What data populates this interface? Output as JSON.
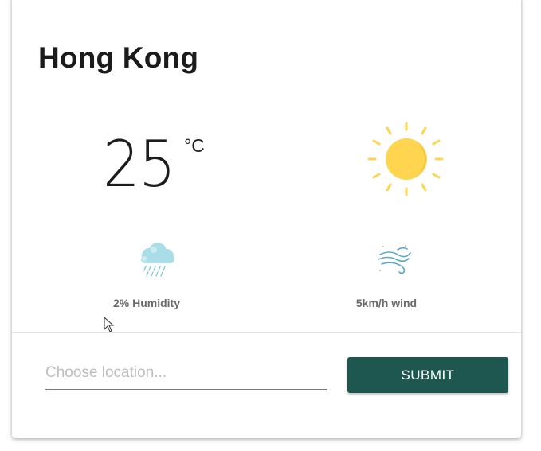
{
  "weather": {
    "city": "Hong Kong",
    "temperature": "25",
    "unit": "°C",
    "condition_icon": "sun-icon",
    "humidity_icon": "rain-cloud-icon",
    "wind_icon": "wind-icon",
    "humidity_label": "2% Humidity",
    "wind_label": "5km/h wind"
  },
  "form": {
    "placeholder": "Choose location...",
    "value": "",
    "submit_label": "SUBMIT"
  },
  "colors": {
    "button": "#1e5650",
    "sun": "#ffd54f",
    "sun_rays": "#ffd54f",
    "cloud": "#a9dde8",
    "label": "#6b6b6b"
  }
}
